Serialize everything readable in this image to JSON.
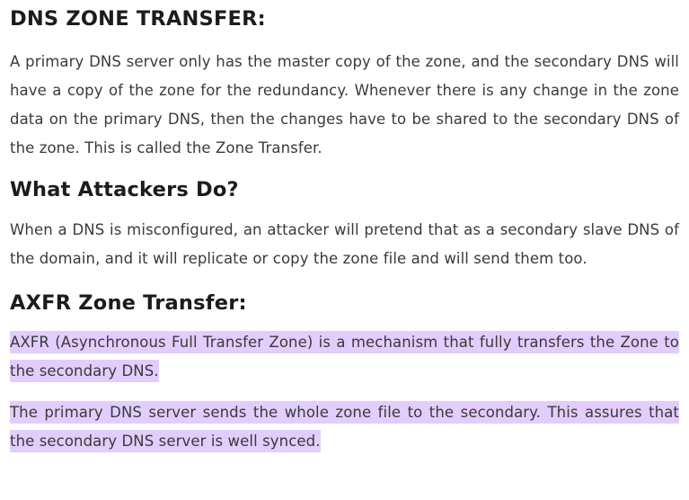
{
  "sections": [
    {
      "heading": "DNS ZONE TRANSFER:",
      "paragraphs": [
        "A primary DNS server only has the master copy of the zone, and the secondary DNS will have a copy of the zone for the redundancy. Whenever there is any change in the zone data on the primary DNS, then the changes have to be shared to the secondary DNS of the zone. This is called the Zone Transfer."
      ]
    },
    {
      "heading": "What Attackers Do?",
      "paragraphs": [
        "When a DNS is misconfigured, an attacker will pretend that as a secondary slave DNS of the domain, and it will replicate or copy the zone file and will send them too."
      ]
    },
    {
      "heading": "AXFR Zone Transfer:",
      "paragraphs": [
        "AXFR (Asynchronous Full Transfer Zone) is a mechanism that fully transfers the Zone to the secondary DNS.",
        "The primary DNS server sends the whole zone file to the secondary. This assures that the secondary DNS server is well synced."
      ]
    }
  ],
  "colors": {
    "heading": "#1c1c1c",
    "body_text": "#3a3a3a",
    "highlight": "#e2cdfc"
  }
}
